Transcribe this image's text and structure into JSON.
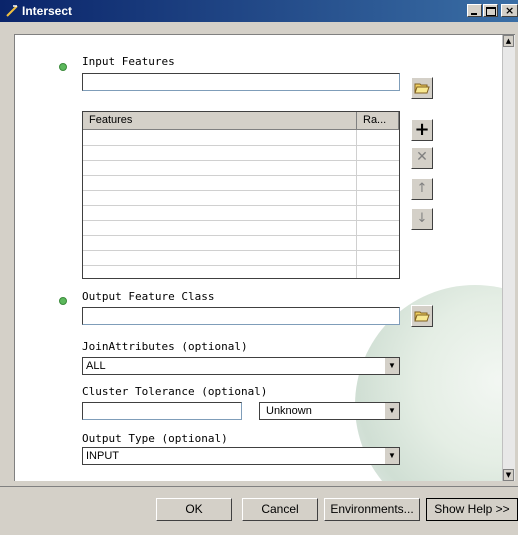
{
  "window": {
    "title": "Intersect"
  },
  "fields": {
    "input_features": {
      "label": "Input Features",
      "value": ""
    },
    "features_table": {
      "col_features": "Features",
      "col_rank": "Ra...",
      "rows": [
        "",
        "",
        "",
        "",
        "",
        "",
        "",
        "",
        "",
        ""
      ]
    },
    "output_feature_class": {
      "label": "Output Feature Class",
      "value": ""
    },
    "join_attributes": {
      "label": "JoinAttributes (optional)",
      "value": "ALL"
    },
    "cluster_tolerance": {
      "label": "Cluster Tolerance (optional)",
      "value": "",
      "unit": "Unknown"
    },
    "output_type": {
      "label": "Output Type (optional)",
      "value": "INPUT"
    }
  },
  "footer": {
    "ok": "OK",
    "cancel": "Cancel",
    "environments": "Environments...",
    "show_help": "Show Help >>"
  },
  "colors": {
    "titlebar": "#0a246a",
    "required_dot": "#5cb85c"
  }
}
